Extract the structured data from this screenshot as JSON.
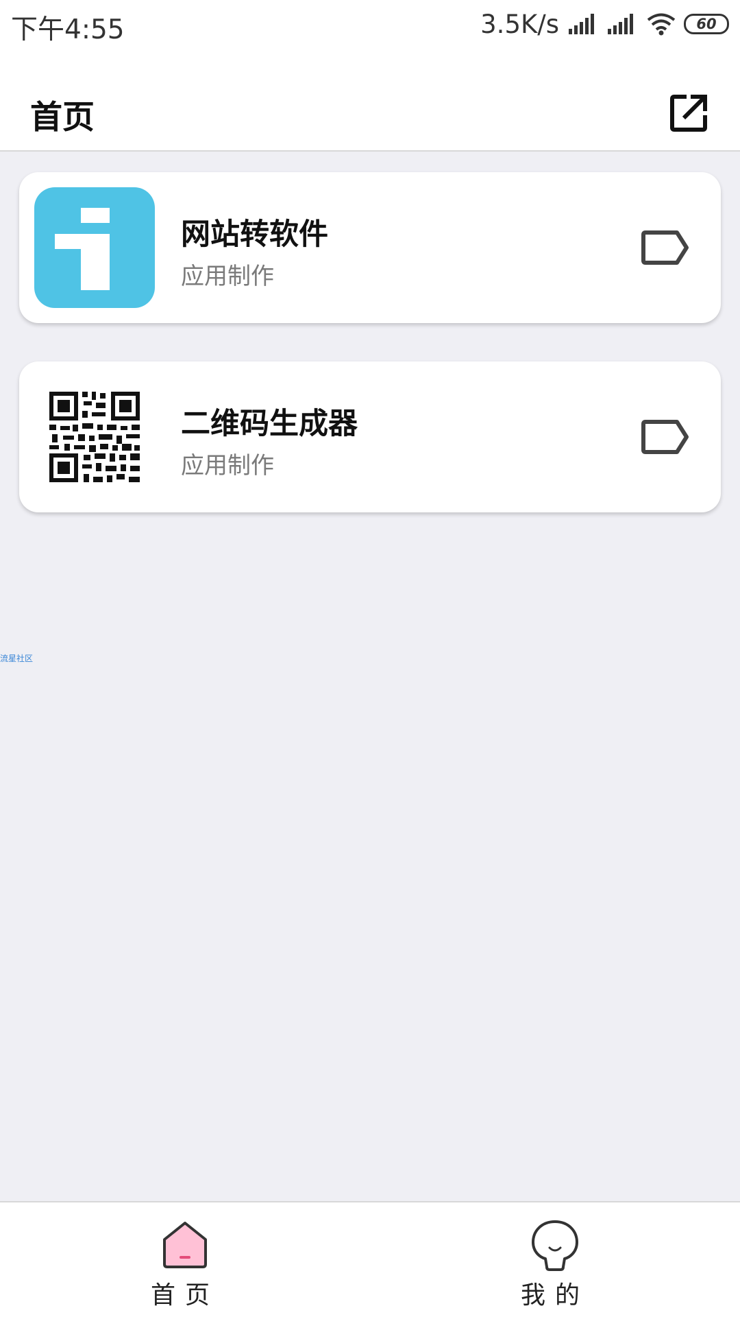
{
  "status_bar": {
    "time": "下午4:55",
    "net_speed": "3.5K/s",
    "battery": "60"
  },
  "header": {
    "title": "首页",
    "action_icon": "external-link-icon"
  },
  "cards": [
    {
      "title": "网站转软件",
      "subtitle": "应用制作",
      "icon": "app-i-icon",
      "icon_color": "#4fc3e5",
      "trailing_icon": "tag-icon"
    },
    {
      "title": "二维码生成器",
      "subtitle": "应用制作",
      "icon": "qr-code-icon",
      "trailing_icon": "tag-icon"
    }
  ],
  "watermark": "流星社区",
  "bottom_nav": {
    "items": [
      {
        "label": "首页",
        "icon": "home-icon",
        "active": true
      },
      {
        "label": "我的",
        "icon": "profile-icon",
        "active": false
      }
    ]
  },
  "colors": {
    "background": "#efeff4",
    "accent": "#4fc3e5",
    "home_active": "#ffc1d6"
  }
}
